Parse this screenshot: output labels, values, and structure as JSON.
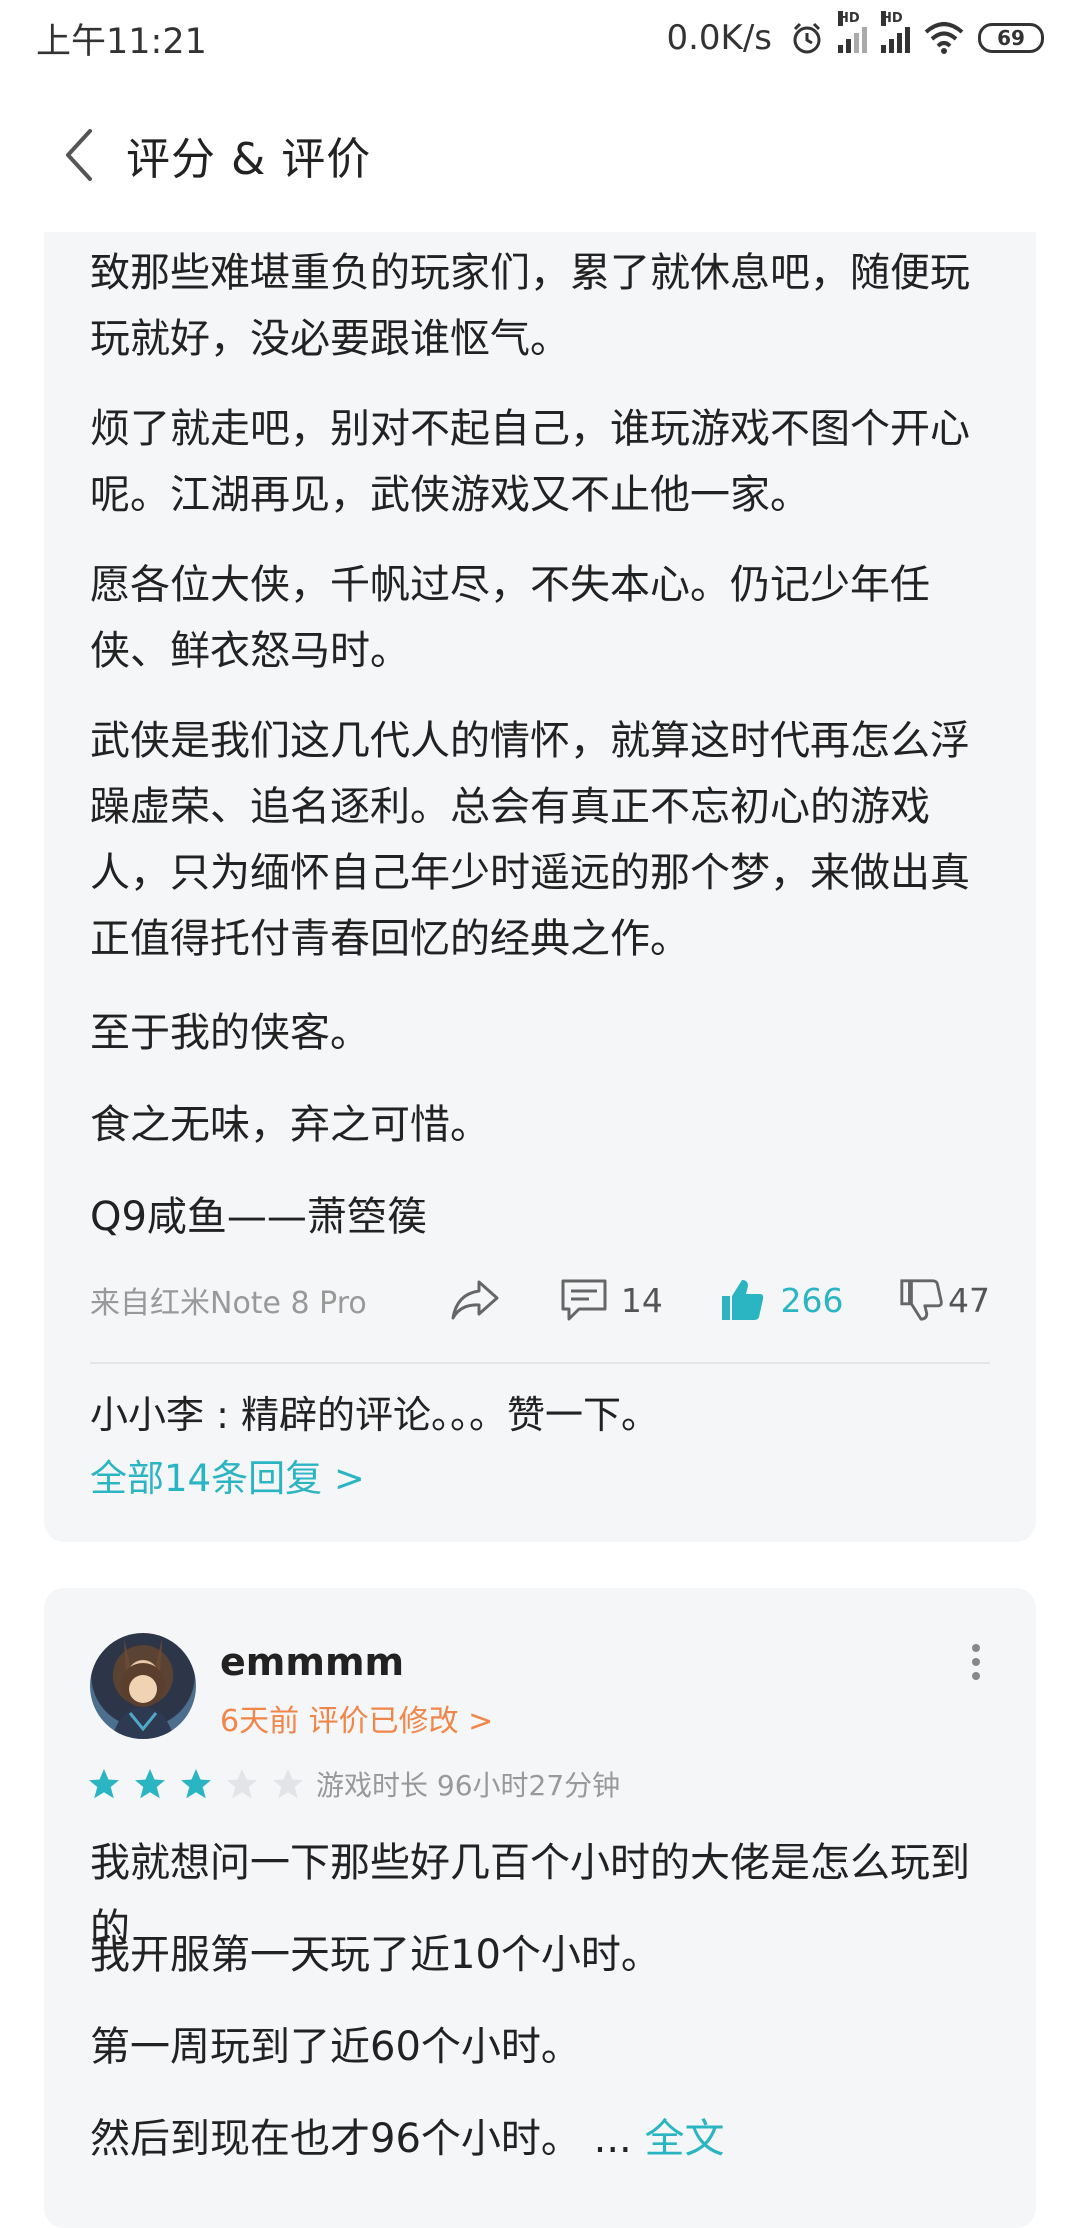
{
  "status_bar": {
    "time": "上午11:21",
    "net_speed": "0.0K/s",
    "battery": "69",
    "hd1": "HD",
    "hd2": "HD"
  },
  "header": {
    "title": "评分 & 评价"
  },
  "review1": {
    "paragraphs": [
      "致那些难堪重负的玩家们，累了就休息吧，随便玩玩就好，没必要跟谁怄气。",
      "烦了就走吧，别对不起自己，谁玩游戏不图个开心呢。江湖再见，武侠游戏又不止他一家。",
      "愿各位大侠，千帆过尽，不失本心。仍记少年任侠、鲜衣怒马时。",
      "武侠是我们这几代人的情怀，就算这时代再怎么浮躁虚荣、追名逐利。总会有真正不忘初心的游戏人，只为缅怀自己年少时遥远的那个梦，来做出真正值得托付青春回忆的经典之作。",
      "至于我的侠客。",
      "食之无味，弃之可惜。",
      "Q9咸鱼——萧箜篌"
    ],
    "device": "来自红米Note 8 Pro",
    "comments": "14",
    "likes": "266",
    "dislikes": "47",
    "top_reply": "小小李 : 精辟的评论。。。赞一下。",
    "all_replies": "全部14条回复 >"
  },
  "review2": {
    "username": "emmmm",
    "time_edited": "6天前 评价已修改 >",
    "rating": 3,
    "rating_max": 5,
    "playtime": "游戏时长 96小时27分钟",
    "paragraphs": [
      "我就想问一下那些好几百个小时的大佬是怎么玩到的",
      "我开服第一天玩了近10个小时。",
      "第一周玩到了近60个小时。"
    ],
    "last_line": "然后到现在也才96个小时。 ...",
    "fulltext_label": "全文"
  },
  "colors": {
    "accent": "#2bb5c3",
    "orange": "#f0864a",
    "card_bg": "#f5f6f8"
  }
}
